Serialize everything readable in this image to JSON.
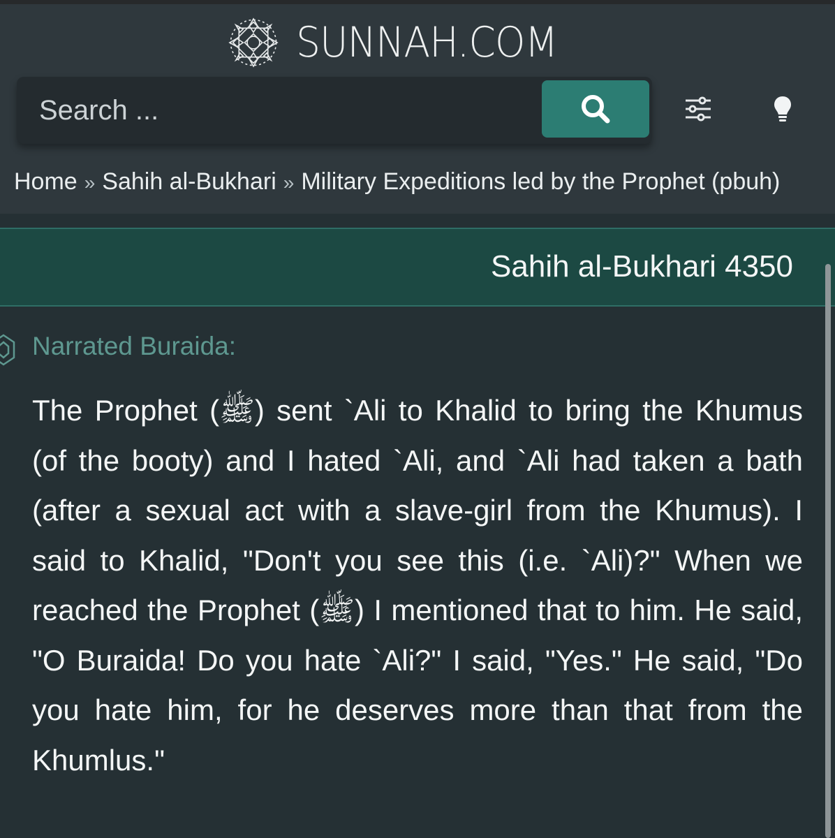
{
  "site": {
    "name": "SUNNAH.COM"
  },
  "icons": {
    "logo": "geometric-star-pattern",
    "search": "search-icon",
    "settings": "sliders-icon",
    "theme": "lightbulb-icon",
    "narrator": "ornament-icon"
  },
  "search": {
    "placeholder": "Search ..."
  },
  "breadcrumb": {
    "separator": "»",
    "items": [
      "Home",
      "Sahih al-Bukhari",
      "Military Expeditions led by the Prophet (pbuh)"
    ]
  },
  "hadith": {
    "title": "Sahih al-Bukhari 4350",
    "narrator": "Narrated Buraida:",
    "text": "The Prophet (ﷺ) sent `Ali to Khalid to bring the Khumus (of the booty) and I hated `Ali, and `Ali had taken a bath (after a sexual act with a slave-girl from the Khumus). I said to Khalid, \"Don't you see this (i.e. `Ali)?\" When we reached the Prophet (ﷺ) I mentioned that to him. He said, \"O Buraida! Do you hate `Ali?\" I said, \"Yes.\" He said, \"Do you hate him, for he deserves more than that from the Khumlus.\""
  },
  "colors": {
    "background": "#253034",
    "header": "#2f383d",
    "accent": "#2c7d73",
    "title_bar": "#1c4943",
    "narrator": "#5e9890"
  }
}
